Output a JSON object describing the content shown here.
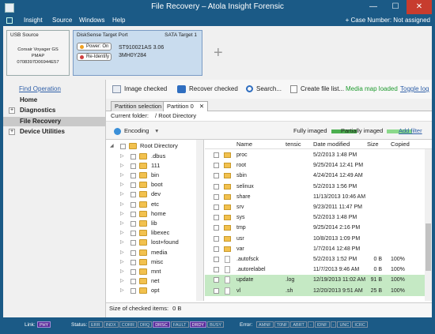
{
  "window": {
    "title": "File Recovery – Atola Insight Forensic",
    "close_label": "✕",
    "min_label": "—",
    "max_label": "☐"
  },
  "menu": {
    "items": [
      "Insight",
      "Source",
      "Windows",
      "Help"
    ],
    "case_label": "+ Case Number:",
    "case_value": "Not assigned"
  },
  "usb_source": {
    "header": "USB Source",
    "lines": [
      "Corsair Voyager GS",
      "PMAP",
      "0708397D06944E57"
    ]
  },
  "port": {
    "header": "DiskSense Target Port",
    "sata": "SATA Target 1",
    "power_label": "Power: On",
    "reidentify_label": "Re-Identify",
    "model": "ST910021AS 3.06",
    "serial": "3MH0Y284"
  },
  "sidebar": {
    "find_operation": "Find Operation",
    "items": [
      {
        "label": "Home",
        "expander": ""
      },
      {
        "label": "Diagnostics",
        "expander": "+"
      },
      {
        "label": "File Recovery",
        "expander": ""
      },
      {
        "label": "Device Utilities",
        "expander": "+"
      }
    ]
  },
  "toolbar": {
    "image_checked": "Image checked",
    "recover_checked": "Recover checked",
    "search": "Search...",
    "create_file_list": "Create file list...",
    "media_map_loaded": "Media map loaded",
    "toggle_log": "Toggle log"
  },
  "tabs": [
    "Partition selection",
    "Partition 0"
  ],
  "tab_close": "✕",
  "current_folder": {
    "label": "Current folder:",
    "value": "/ Root Directory"
  },
  "actionbar": {
    "encoding": "Encoding",
    "fully_imaged": "Fully imaged",
    "partially_imaged": "Partially imaged",
    "add_filter": "Add filter"
  },
  "colors": {
    "fully_imaged": "#4caf50",
    "partially_imaged": "#8bd98b",
    "highlight_row": "#c5e9c4",
    "accent": "#1b5a86"
  },
  "tree": {
    "root": "Root Directory",
    "items": [
      ".dbus",
      "111",
      "bin",
      "boot",
      "dev",
      "etc",
      "home",
      "lib",
      "libexec",
      "lost+found",
      "media",
      "misc",
      "mnt",
      "net",
      "opt"
    ]
  },
  "files": {
    "headers": {
      "name": "Name",
      "ext": "tensic",
      "date": "Date modified",
      "size": "Size",
      "copied": "Copied"
    },
    "rows": [
      {
        "name": "proc",
        "ext": "",
        "date": "5/2/2013 1:48 PM",
        "size": "",
        "copied": "",
        "type": "folder",
        "hl": false
      },
      {
        "name": "root",
        "ext": "",
        "date": "9/25/2014 12:41 PM",
        "size": "",
        "copied": "",
        "type": "folder",
        "hl": false
      },
      {
        "name": "sbin",
        "ext": "",
        "date": "4/24/2014 12:49 AM",
        "size": "",
        "copied": "",
        "type": "folder",
        "hl": false
      },
      {
        "name": "selinux",
        "ext": "",
        "date": "5/2/2013 1:56 PM",
        "size": "",
        "copied": "",
        "type": "folder",
        "hl": false
      },
      {
        "name": "share",
        "ext": "",
        "date": "11/13/2013 10:46 AM",
        "size": "",
        "copied": "",
        "type": "folder",
        "hl": false
      },
      {
        "name": "srv",
        "ext": "",
        "date": "9/23/2011 11:47 PM",
        "size": "",
        "copied": "",
        "type": "folder",
        "hl": false
      },
      {
        "name": "sys",
        "ext": "",
        "date": "5/2/2013 1:48 PM",
        "size": "",
        "copied": "",
        "type": "folder",
        "hl": false
      },
      {
        "name": "tmp",
        "ext": "",
        "date": "9/25/2014 2:16 PM",
        "size": "",
        "copied": "",
        "type": "folder",
        "hl": false
      },
      {
        "name": "usr",
        "ext": "",
        "date": "10/8/2013 1:09 PM",
        "size": "",
        "copied": "",
        "type": "folder",
        "hl": false
      },
      {
        "name": "var",
        "ext": "",
        "date": "1/7/2014 12:48 PM",
        "size": "",
        "copied": "",
        "type": "folder",
        "hl": false
      },
      {
        "name": ".autofsck",
        "ext": "",
        "date": "5/2/2013 1:52 PM",
        "size": "0 B",
        "copied": "100%",
        "type": "file",
        "hl": false
      },
      {
        "name": ".autorelabel",
        "ext": "",
        "date": "11/7/2013 9:46 AM",
        "size": "0 B",
        "copied": "100%",
        "type": "file",
        "hl": false
      },
      {
        "name": "update",
        "ext": ".log",
        "date": "12/19/2013 11:02 AM",
        "size": "91 B",
        "copied": "100%",
        "type": "file",
        "hl": true
      },
      {
        "name": "vl",
        "ext": ".sh",
        "date": "12/20/2013 9:51 AM",
        "size": "25 B",
        "copied": "100%",
        "type": "file",
        "hl": true
      }
    ]
  },
  "size_checked": {
    "label": "Size of checked items:",
    "value": "0 B"
  },
  "statusbar": {
    "link_label": "Link:",
    "link_value": "PHY",
    "status_label": "Status:",
    "status_badges": [
      {
        "t": "ERR",
        "on": false
      },
      {
        "t": "INDX",
        "on": false
      },
      {
        "t": "CORR",
        "on": false
      },
      {
        "t": "DRQ",
        "on": false
      },
      {
        "t": "DRSC",
        "on": true
      },
      {
        "t": "FAULT",
        "on": false
      },
      {
        "t": "DRDY",
        "on": true
      },
      {
        "t": "BUSY",
        "on": false
      }
    ],
    "error_label": "Error:",
    "error_badges": [
      "AMNF",
      "T0NF",
      "ABRT",
      "-",
      "IDNF",
      "-",
      "UNC",
      "ICRC"
    ]
  }
}
